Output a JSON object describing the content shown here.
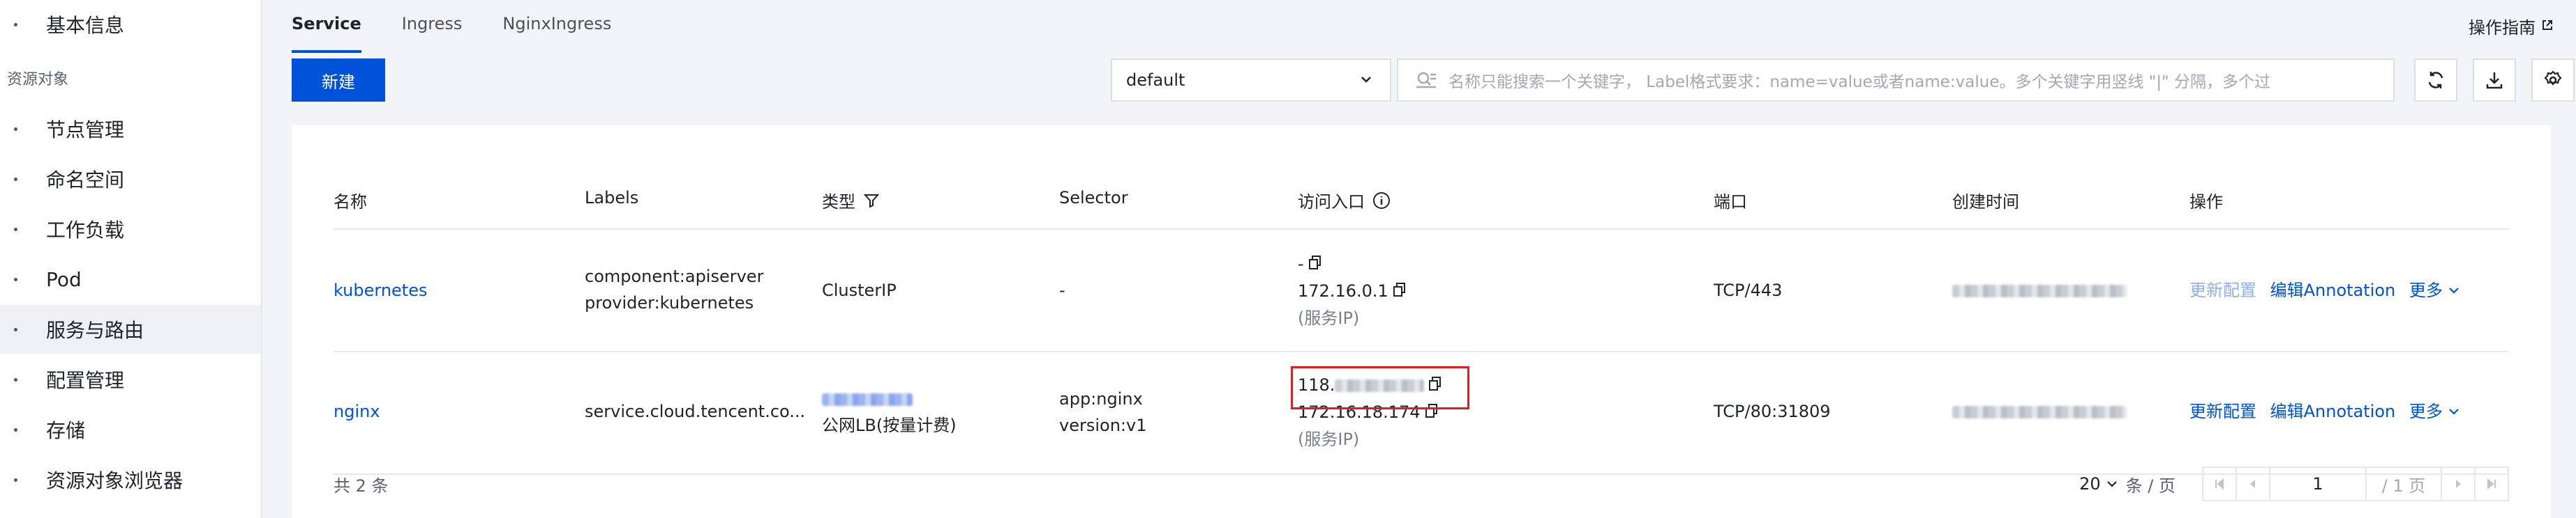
{
  "sidebar": {
    "items": [
      {
        "label": "基本信息"
      },
      {
        "label": "节点管理"
      },
      {
        "label": "命名空间"
      },
      {
        "label": "工作负载"
      },
      {
        "label": "Pod"
      },
      {
        "label": "服务与路由"
      },
      {
        "label": "配置管理"
      },
      {
        "label": "存储"
      },
      {
        "label": "资源对象浏览器"
      }
    ],
    "section_label": "资源对象",
    "active": "服务与路由"
  },
  "tabs": [
    {
      "label": "Service",
      "active": true
    },
    {
      "label": "Ingress",
      "active": false
    },
    {
      "label": "NginxIngress",
      "active": false
    }
  ],
  "guide_label": "操作指南",
  "toolbar": {
    "new_label": "新建",
    "namespace": "default",
    "search_placeholder": "名称只能搜索一个关键字， Label格式要求：name=value或者name:value。多个关键字用竖线 \"|\" 分隔，多个过"
  },
  "table": {
    "headers": [
      "名称",
      "Labels",
      "类型",
      "Selector",
      "访问入口",
      "端口",
      "创建时间",
      "操作"
    ],
    "rows": [
      {
        "name": "kubernetes",
        "labels": [
          "component:apiserver",
          "provider:kubernetes"
        ],
        "type": "ClusterIP",
        "selector": "-",
        "access": [
          "-",
          "172.16.0.1",
          "(服务IP)"
        ],
        "port": "TCP/443",
        "actions": [
          "更新配置",
          "编辑Annotation",
          "更多"
        ]
      },
      {
        "name": "nginx",
        "labels": [
          "service.cloud.tencent.co..."
        ],
        "type": "公网LB(按量计费)",
        "selector": [
          "app:nginx",
          "version:v1"
        ],
        "access": [
          "118.",
          "172.16.18.174",
          "(服务IP)"
        ],
        "port": "TCP/80:31809",
        "actions": [
          "更新配置",
          "编辑Annotation",
          "更多"
        ]
      }
    ]
  },
  "footer": {
    "total": "共 2 条",
    "page_size": "20",
    "per_page_label": "条 / 页",
    "current_page": "1",
    "total_pages": "/ 1 页"
  },
  "colors": {
    "primary": "#0052d9",
    "highlight": "#e02020"
  }
}
